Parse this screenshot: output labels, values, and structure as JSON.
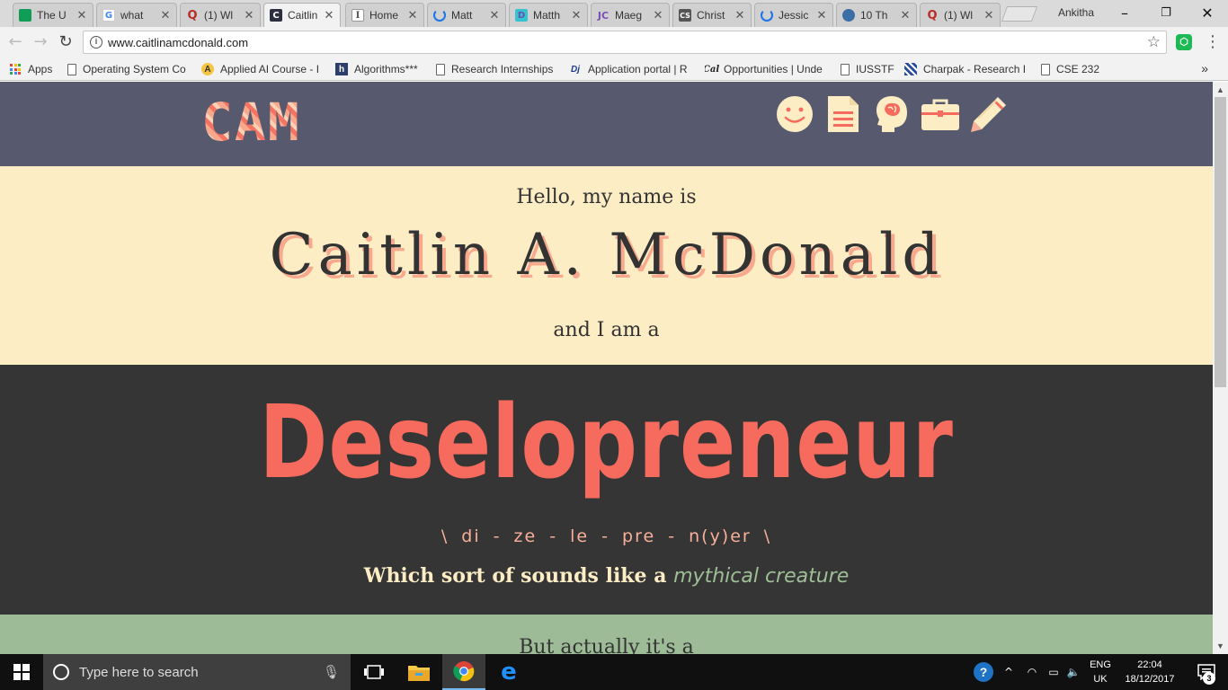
{
  "browser": {
    "tabs": [
      {
        "title": "The U",
        "favicon": "classroom-icon",
        "color": "#0f9d58"
      },
      {
        "title": "what",
        "favicon": "google-icon",
        "color": "#4285f4"
      },
      {
        "title": "(1) Wl",
        "favicon": "quora-icon",
        "color": "#b92b27"
      },
      {
        "title": "Caitlin",
        "favicon": "cam-site-icon",
        "color": "#2d2f3f",
        "active": true
      },
      {
        "title": "Home",
        "favicon": "instapaper-icon",
        "color": "#555555"
      },
      {
        "title": "Matt",
        "favicon": "loading-icon",
        "color": "#1a73e8"
      },
      {
        "title": "Matth",
        "favicon": "d-icon",
        "color": "#6a4fb0"
      },
      {
        "title": "Maeg",
        "favicon": "jc-icon",
        "color": "#7b4fb5"
      },
      {
        "title": "Christ",
        "favicon": "cs-icon",
        "color": "#555555"
      },
      {
        "title": "Jessic",
        "favicon": "loading-icon",
        "color": "#1a73e8"
      },
      {
        "title": "10 Th",
        "favicon": "globe-icon",
        "color": "#3b6ea5"
      },
      {
        "title": "(1) Wl",
        "favicon": "quora-icon",
        "color": "#b92b27"
      }
    ],
    "profile_name": "Ankitha",
    "url": "www.caitlinamcdonald.com",
    "bookmarks": [
      {
        "label": "Apps",
        "icon": "apps-grid-icon"
      },
      {
        "label": "Operating System Co",
        "icon": "page-icon"
      },
      {
        "label": "Applied AI Course - I",
        "icon": "appliedai-icon"
      },
      {
        "label": "Algorithms***",
        "icon": "h-icon"
      },
      {
        "label": "Research Internships",
        "icon": "page-icon"
      },
      {
        "label": "Application portal | R",
        "icon": "dj-icon"
      },
      {
        "label": "Opportunities | Unde",
        "icon": "cal-icon"
      },
      {
        "label": "IUSSTF",
        "icon": "page-icon"
      },
      {
        "label": "Charpak - Research I",
        "icon": "charpak-icon"
      },
      {
        "label": "CSE 232",
        "icon": "page-icon"
      }
    ]
  },
  "site": {
    "logo_text": "CAM",
    "nav_icons": [
      "smiley-icon",
      "document-icon",
      "brain-head-icon",
      "briefcase-icon",
      "pencil-icon"
    ],
    "greeting": "Hello, my name is",
    "name": "Caitlin A. McDonald",
    "and_i_am": "and I am a",
    "title_word": "Deselopreneur",
    "pronunciation": "\\ di - ze - le - pre - n(y)er \\",
    "sounds_like": "Which sort of sounds like a ",
    "mythical": "mythical creature",
    "but_actually": "But actually it's a",
    "colors": {
      "header": "#575a6e",
      "cream": "#fdedc5",
      "coral": "#f66b5d",
      "dark": "#353535",
      "sage": "#9dbb96"
    }
  },
  "taskbar": {
    "search_placeholder": "Type here to search",
    "lang_line1": "ENG",
    "lang_line2": "UK",
    "time": "22:04",
    "date": "18/12/2017",
    "notification_count": "3"
  }
}
